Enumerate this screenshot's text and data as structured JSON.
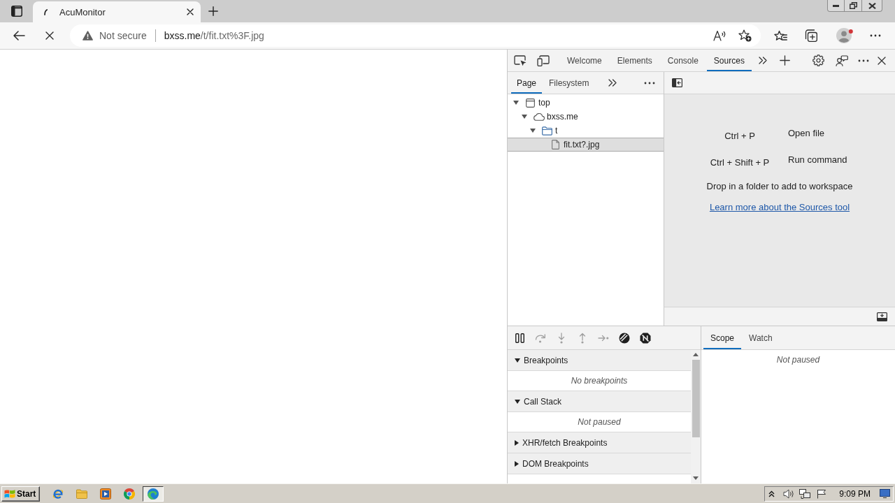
{
  "browser": {
    "loading": true,
    "tabs": [
      {
        "title": "AcuMonitor",
        "selected": true
      }
    ],
    "address": {
      "security": "Not secure",
      "host": "bxss.me",
      "path": "/t/fit.txt%3F.jpg"
    }
  },
  "devtools": {
    "tabs": [
      {
        "label": "Welcome",
        "selected": false
      },
      {
        "label": "Elements",
        "selected": false
      },
      {
        "label": "Console",
        "selected": false
      },
      {
        "label": "Sources",
        "selected": true
      }
    ],
    "navigator": {
      "tabs": [
        {
          "label": "Page",
          "selected": true
        },
        {
          "label": "Filesystem",
          "selected": false
        }
      ],
      "tree": [
        {
          "label": "top",
          "kind": "frame",
          "expanded": true,
          "selected": false,
          "children": [
            {
              "label": "bxss.me",
              "kind": "domain",
              "expanded": true,
              "selected": false,
              "children": [
                {
                  "label": "t",
                  "kind": "folder",
                  "expanded": true,
                  "selected": false,
                  "children": [
                    {
                      "label": "fit.txt?.jpg",
                      "kind": "file",
                      "selected": true
                    }
                  ]
                }
              ]
            }
          ]
        }
      ]
    },
    "editor": {
      "shortcuts": [
        {
          "keys": "Ctrl + P",
          "action": "Open file"
        },
        {
          "keys": "Ctrl + Shift + P",
          "action": "Run command"
        }
      ],
      "hint": "Drop in a folder to add to workspace",
      "link": "Learn more about the Sources tool"
    },
    "debugger": {
      "controls": [
        {
          "kind": "pause",
          "disabled": false
        },
        {
          "kind": "step-over",
          "disabled": true
        },
        {
          "kind": "step-into",
          "disabled": true
        },
        {
          "kind": "step-out",
          "disabled": true
        },
        {
          "kind": "step",
          "disabled": true
        },
        {
          "kind": "deactivate",
          "disabled": false
        },
        {
          "kind": "pause-exceptions",
          "disabled": false
        }
      ],
      "sections": [
        {
          "title": "Breakpoints",
          "expanded": true,
          "message": "No breakpoints"
        },
        {
          "title": "Call Stack",
          "expanded": true,
          "message": "Not paused"
        },
        {
          "title": "XHR/fetch Breakpoints",
          "expanded": false
        },
        {
          "title": "DOM Breakpoints",
          "expanded": false
        }
      ],
      "sidebar": {
        "tabs": [
          {
            "label": "Scope",
            "selected": true
          },
          {
            "label": "Watch",
            "selected": false
          }
        ],
        "message": "Not paused"
      }
    }
  },
  "taskbar": {
    "start": "Start",
    "apps": [
      {
        "kind": "ie",
        "selected": false
      },
      {
        "kind": "explorer",
        "selected": false
      },
      {
        "kind": "media",
        "selected": false
      },
      {
        "kind": "chrome",
        "selected": false
      },
      {
        "kind": "edge",
        "selected": true
      }
    ],
    "clock": "9:09 PM"
  }
}
